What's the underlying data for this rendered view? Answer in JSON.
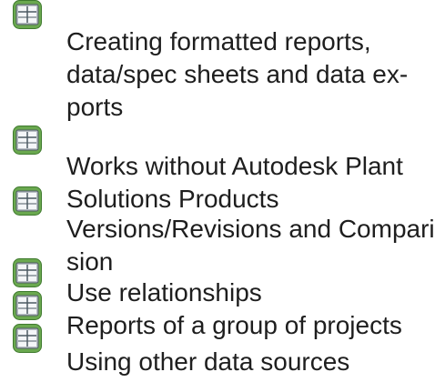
{
  "features": [
    {
      "icon": "spreadsheet-icon",
      "lines": [
        "Creating formatted reports,",
        "data/spec sheets and data ex-",
        "ports"
      ]
    },
    {
      "icon": "spreadsheet-icon",
      "lines": [
        "Works without Autodesk Plant",
        "Solutions Products"
      ]
    },
    {
      "icon": "spreadsheet-icon",
      "lines": [
        "Versions/Revisions and Compari-",
        "sion"
      ]
    },
    {
      "icon": "spreadsheet-icon",
      "lines": [
        "Use relationships"
      ]
    },
    {
      "icon": "spreadsheet-icon",
      "lines": [
        "Reports of a group of projects"
      ]
    },
    {
      "icon": "spreadsheet-icon",
      "lines": [
        "Using other data sources"
      ]
    }
  ],
  "colors": {
    "text": "#1e1e1e",
    "icon_green": "#6aa84f",
    "icon_dark_green": "#3f7a2e",
    "icon_gray": "#b9bfc5"
  }
}
